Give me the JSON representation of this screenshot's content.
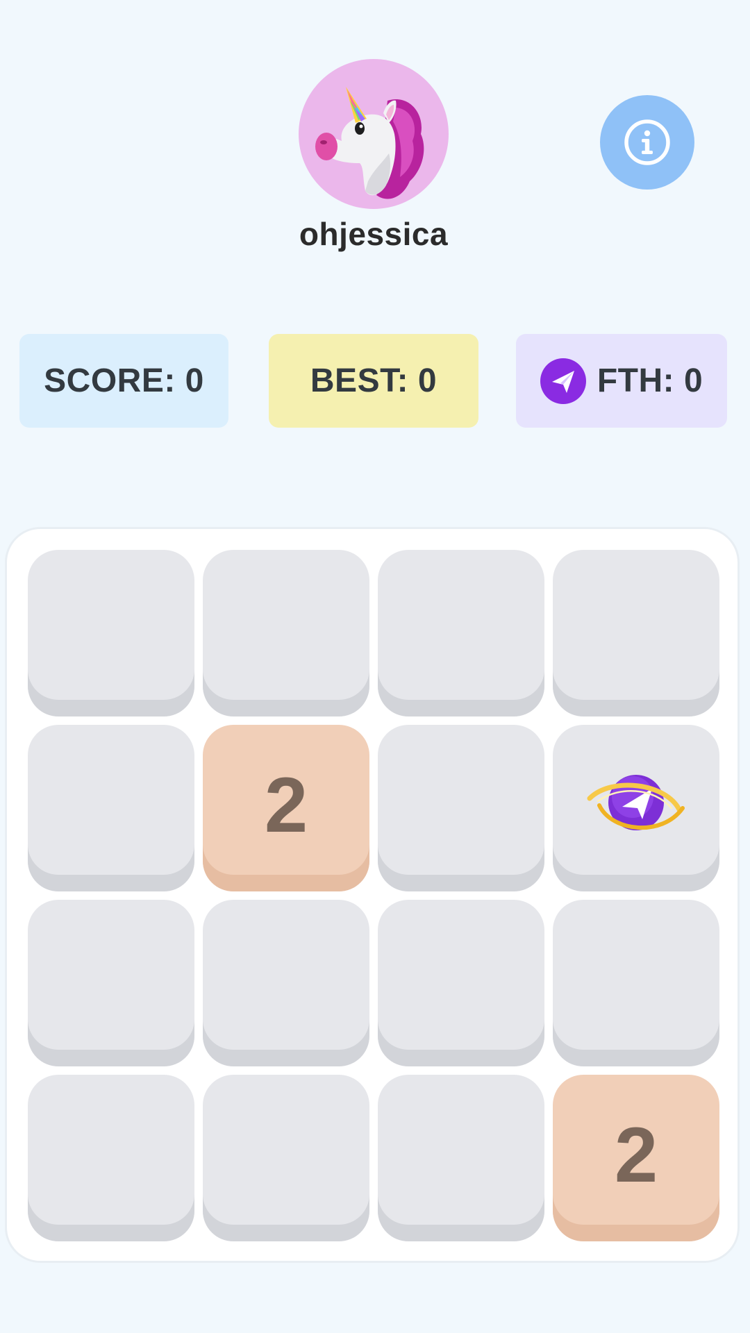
{
  "player": {
    "username": "ohjessica",
    "avatar_icon": "unicorn-icon",
    "avatar_bg": "#ebb7eb"
  },
  "header": {
    "info_icon": "info-icon",
    "info_bg": "#8fc1f7"
  },
  "stats": {
    "score_label": "SCORE: 0",
    "best_label": "BEST: 0",
    "fth_label": "FTH: 0",
    "fth_icon": "fth-token-icon",
    "score_value": 0,
    "best_value": 0,
    "fth_value": 0
  },
  "board": {
    "size": 4,
    "tiles": [
      [
        "",
        "",
        "",
        ""
      ],
      [
        "",
        "2",
        "",
        "powerup"
      ],
      [
        "",
        "",
        "",
        ""
      ],
      [
        "",
        "",
        "",
        "2"
      ]
    ],
    "powerup_icon": "fth-token-swirl-icon",
    "colors": {
      "empty": "#e6e7eb",
      "tile_2": "#f1cfb8",
      "tile_text": "#7a6659",
      "board_bg": "#ffffff",
      "page_bg": "#f1f8fd"
    }
  }
}
